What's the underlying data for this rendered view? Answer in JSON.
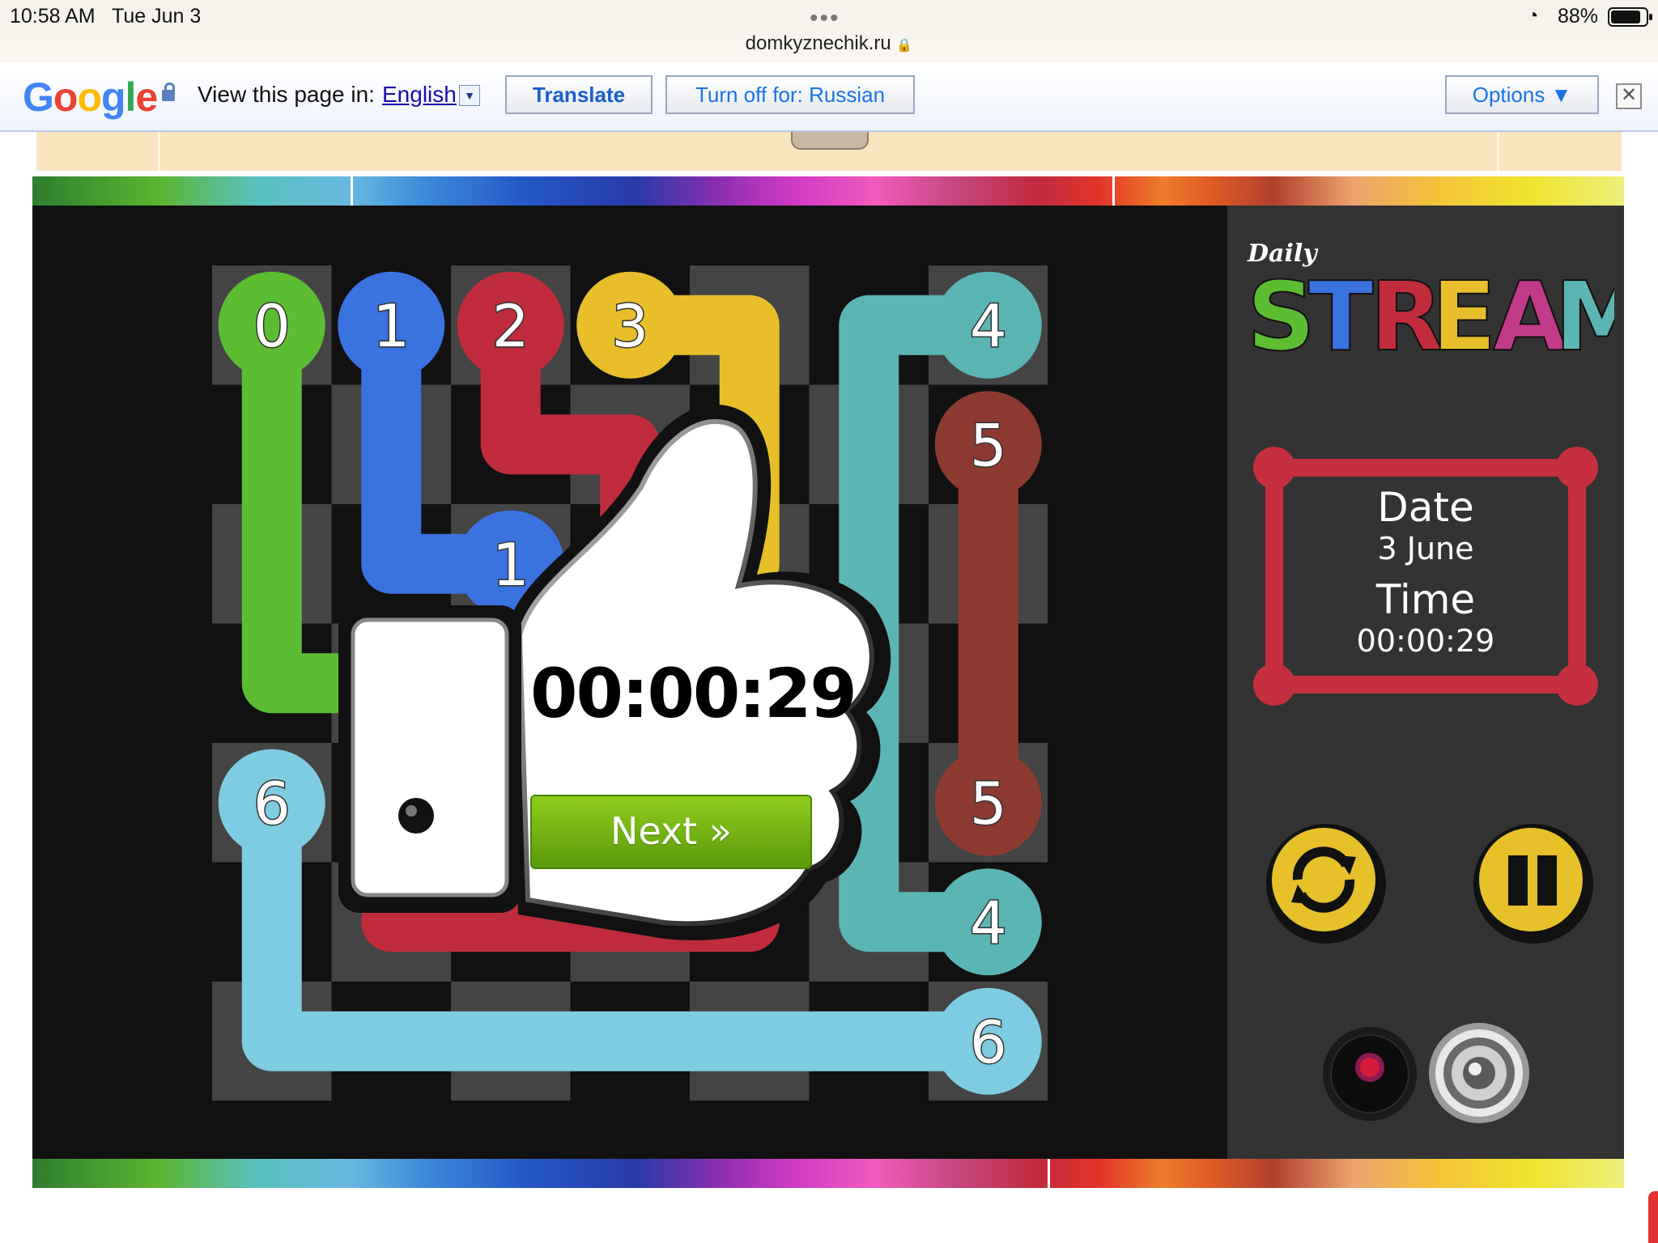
{
  "status_bar": {
    "time": "10:58 AM",
    "date": "Tue Jun 3",
    "url": "domkyznechik.ru",
    "battery": "88%",
    "dots": "•••",
    "lock": "🔒",
    "wifi": "◔"
  },
  "translate_bar": {
    "logo": [
      "G",
      "o",
      "o",
      "g",
      "l",
      "e"
    ],
    "view_label": "View this page in:",
    "language": "English",
    "dropdown_glyph": "▼",
    "translate_label": "Translate",
    "turn_off_label": "Turn off for: Russian",
    "options_label": "Options ▼",
    "close_glyph": "✕"
  },
  "board": {
    "colors": {
      "0": "#5cbd33",
      "1": "#3a72e0",
      "2": "#c02c3c",
      "3": "#e8bf2a",
      "4": "#5cb5b5",
      "5": "#8c3a30",
      "6": "#7dcce2"
    },
    "endpoints": [
      {
        "label": "0",
        "cell": [
          0,
          0
        ],
        "color": "0"
      },
      {
        "label": "1",
        "cell": [
          1,
          0
        ],
        "color": "1"
      },
      {
        "label": "2",
        "cell": [
          2,
          0
        ],
        "color": "2"
      },
      {
        "label": "3",
        "cell": [
          3,
          0
        ],
        "color": "3"
      },
      {
        "label": "4",
        "cell": [
          6,
          0
        ],
        "color": "4"
      },
      {
        "label": "5",
        "cell": [
          6,
          1
        ],
        "color": "5"
      },
      {
        "label": "1",
        "cell": [
          2,
          2
        ],
        "color": "1"
      },
      {
        "label": "6",
        "cell": [
          0,
          4
        ],
        "color": "6"
      },
      {
        "label": "5",
        "cell": [
          6,
          4
        ],
        "color": "5"
      },
      {
        "label": "4",
        "cell": [
          6,
          5
        ],
        "color": "4"
      },
      {
        "label": "6",
        "cell": [
          6,
          6
        ],
        "color": "6"
      }
    ]
  },
  "overlay": {
    "time": "00:00:29",
    "next_label": "Next »"
  },
  "side_panel": {
    "logo_small": "Daily",
    "logo_letters": [
      "S",
      "T",
      "R",
      "E",
      "A",
      "M"
    ],
    "logo_colors": [
      "#5cbd33",
      "#3a72e0",
      "#c02c3c",
      "#e8bf2a",
      "#c23a8a",
      "#5cb5b5"
    ],
    "date_label": "Date",
    "date_value": "3 June",
    "time_label": "Time",
    "time_value": "00:00:29"
  }
}
